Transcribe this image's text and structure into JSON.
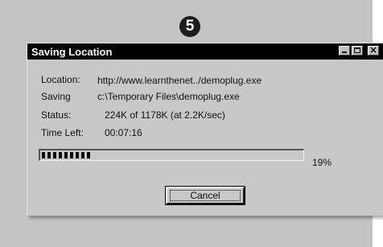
{
  "step_number": "5",
  "dialog": {
    "title": "Saving Location",
    "rows": [
      {
        "label": "Location:",
        "value": "http://www.learnthenet../demoplug.exe"
      },
      {
        "label": "Saving",
        "value": "c:\\Temporary Files\\demoplug.exe"
      },
      {
        "label": "Status:",
        "value": "224K of 1178K (at 2.2K/sec)"
      },
      {
        "label": "Time Left:",
        "value": "00:07:16"
      }
    ],
    "progress_fraction": 0.19,
    "progress_text": "19%",
    "cancel_label": "Cancel"
  },
  "colors": {
    "backdrop": "#c4c4c4",
    "dialog_face": "#c8c8c8",
    "titlebar": "#000000",
    "progress_blocks": "#0a0a0a"
  },
  "icons": {
    "minimize": "minimize-icon",
    "maximize": "maximize-icon",
    "close": "close-icon"
  }
}
